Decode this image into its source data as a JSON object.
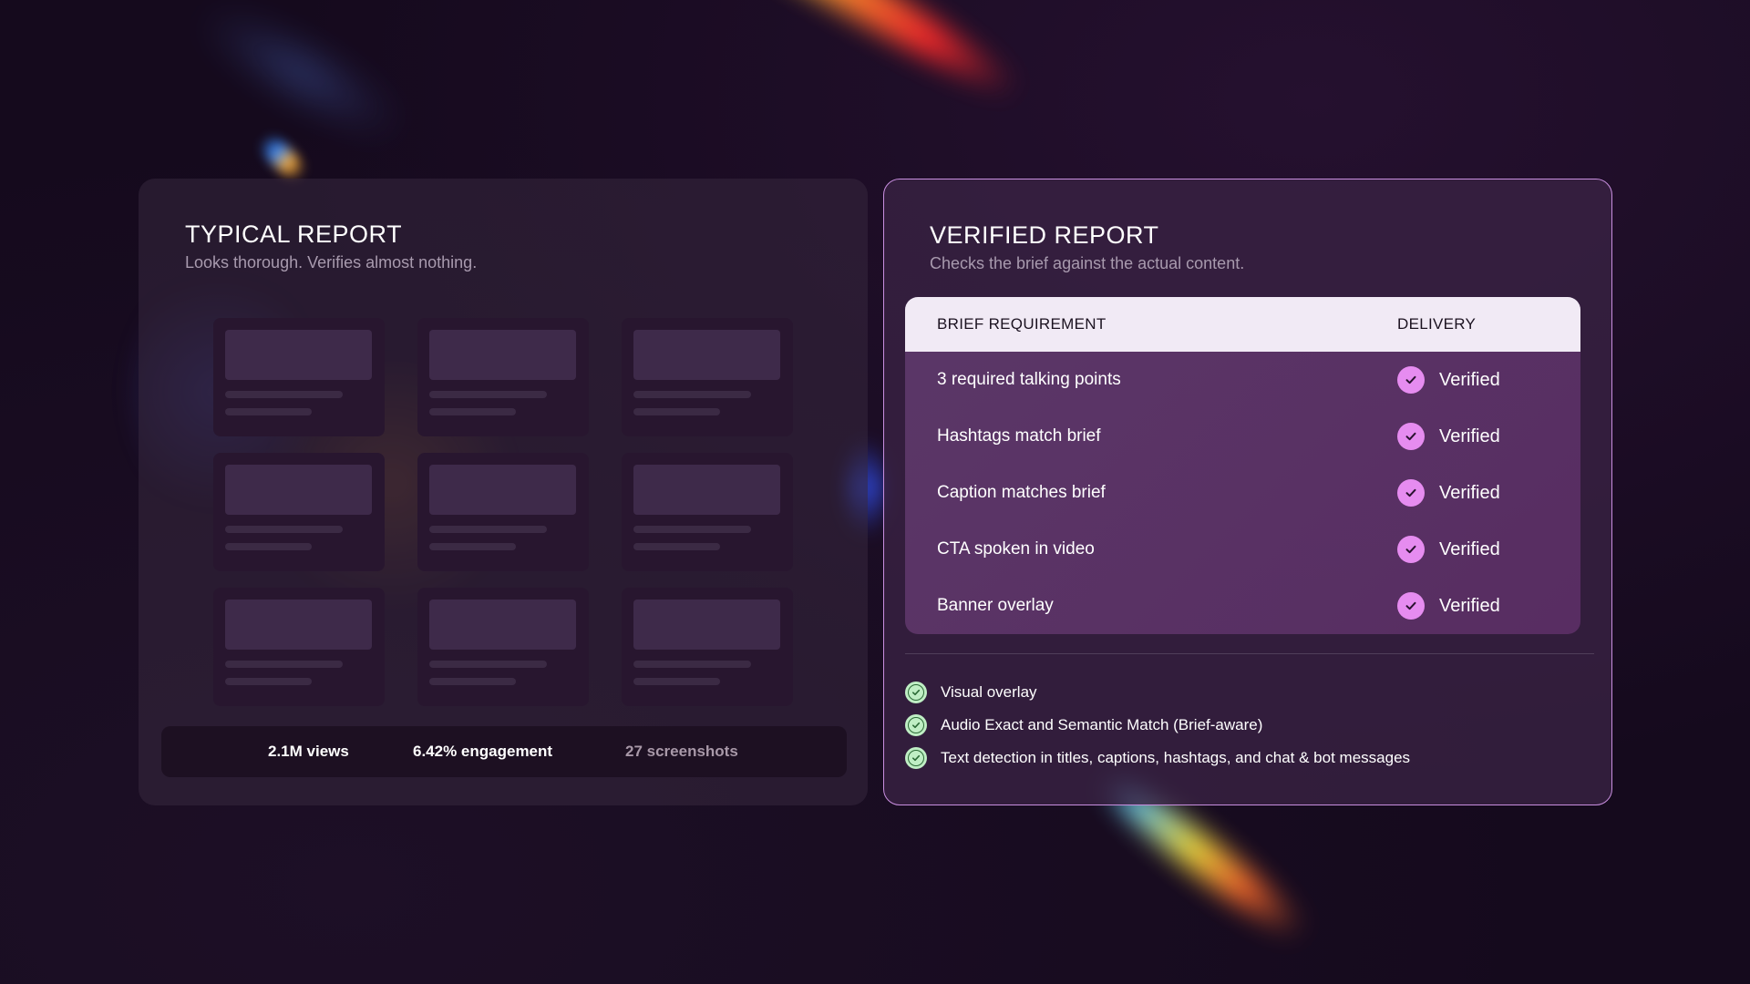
{
  "typical_report": {
    "title": "TYPICAL REPORT",
    "subtitle": "Looks thorough. Verifies almost nothing.",
    "stats": {
      "views": "2.1M views",
      "engagement": "6.42% engagement",
      "screenshots": "27 screenshots"
    }
  },
  "verified_report": {
    "title": "VERIFIED REPORT",
    "subtitle": "Checks the brief against the actual content.",
    "table": {
      "headers": [
        "BRIEF REQUIREMENT",
        "DELIVERY"
      ],
      "rows": [
        {
          "requirement": "3 required talking points",
          "delivery": "Verified"
        },
        {
          "requirement": "Hashtags match brief",
          "delivery": "Verified"
        },
        {
          "requirement": "Caption matches brief",
          "delivery": "Verified"
        },
        {
          "requirement": "CTA spoken in video",
          "delivery": "Verified"
        },
        {
          "requirement": "Banner overlay",
          "delivery": "Verified"
        }
      ]
    },
    "features": [
      "Visual overlay",
      "Audio Exact and Semantic Match (Brief-aware)",
      "Text detection in titles, captions, hashtags, and chat & bot messages"
    ]
  },
  "colors": {
    "background": "#150a1d",
    "verified_badge": "#e68cf0",
    "feature_check": "#bfeec4",
    "card_border": "#c98fe0"
  },
  "icons": {
    "verified": "check-circle-icon",
    "feature": "check-circle-outline-icon"
  }
}
